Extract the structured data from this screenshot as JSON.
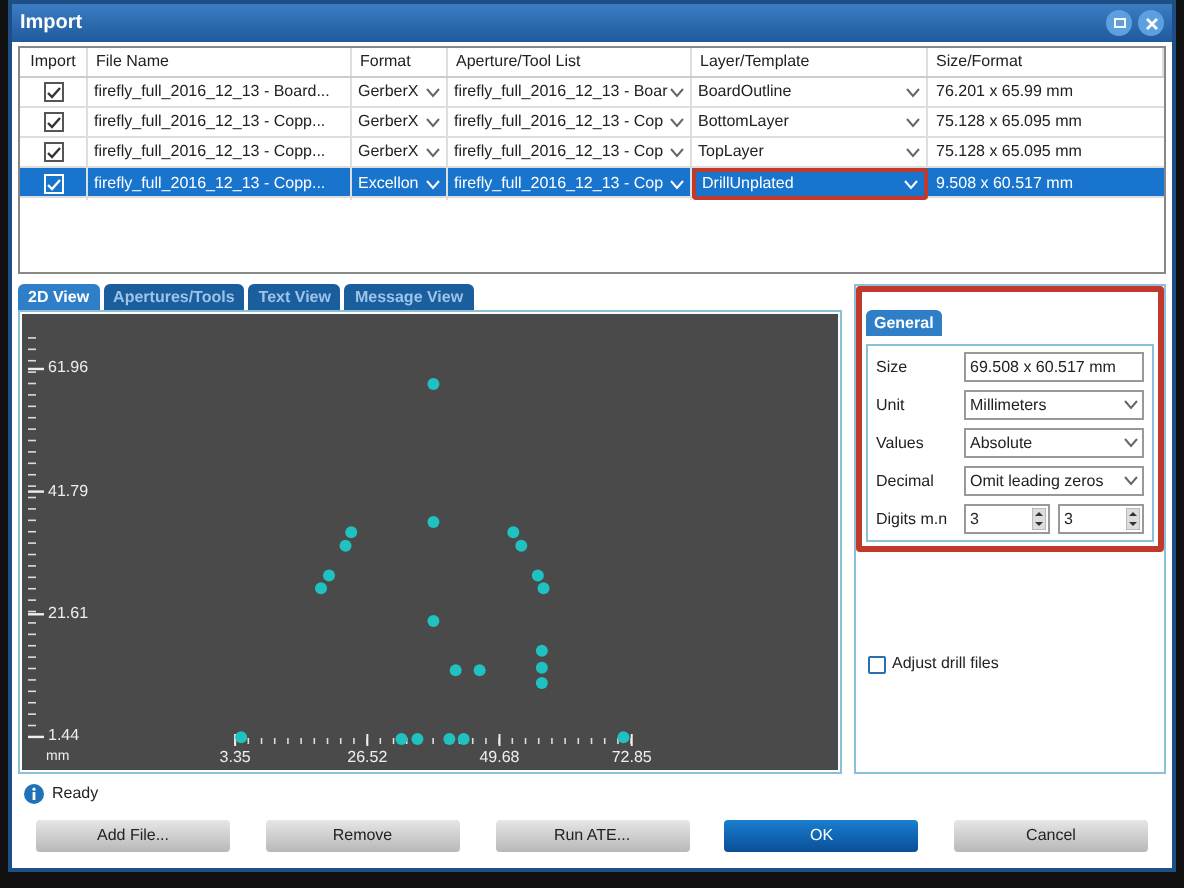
{
  "window": {
    "title": "Import"
  },
  "table": {
    "columns": [
      "Import",
      "File Name",
      "Format",
      "Aperture/Tool List",
      "Layer/Template",
      "Size/Format"
    ],
    "rows": [
      {
        "import": true,
        "file_name": "firefly_full_2016_12_13 - Board...",
        "format": "GerberX",
        "aperture_list": "firefly_full_2016_12_13 - Boar",
        "layer": "BoardOutline",
        "size": "76.201 x 65.99 mm",
        "selected": false,
        "highlighted": false
      },
      {
        "import": true,
        "file_name": "firefly_full_2016_12_13 - Copp...",
        "format": "GerberX",
        "aperture_list": "firefly_full_2016_12_13 - Cop",
        "layer": "BottomLayer",
        "size": "75.128 x 65.095 mm",
        "selected": false,
        "highlighted": false
      },
      {
        "import": true,
        "file_name": "firefly_full_2016_12_13 - Copp...",
        "format": "GerberX",
        "aperture_list": "firefly_full_2016_12_13 - Cop",
        "layer": "TopLayer",
        "size": "75.128 x 65.095 mm",
        "selected": false,
        "highlighted": false
      },
      {
        "import": true,
        "file_name": "firefly_full_2016_12_13 - Copp...",
        "format": "Excellon",
        "aperture_list": "firefly_full_2016_12_13 - Cop",
        "layer": "DrillUnplated",
        "size": "9.508 x 60.517 mm",
        "selected": true,
        "highlighted": true
      }
    ]
  },
  "view_tabs": [
    {
      "label": "2D View",
      "selected": true
    },
    {
      "label": "Apertures/Tools",
      "selected": false
    },
    {
      "label": "Text View",
      "selected": false
    },
    {
      "label": "Message View",
      "selected": false
    }
  ],
  "view": {
    "unit_label": "mm",
    "chart_data": {
      "type": "scatter",
      "x": [
        38.1,
        38.1,
        38.1,
        23.7,
        22.7,
        19.8,
        18.4,
        52.1,
        53.5,
        56.4,
        57.4,
        57.1,
        57.1,
        57.1,
        42.0,
        46.2,
        4.4,
        32.5,
        35.3,
        40.9,
        43.4,
        71.4
      ],
      "series": [
        {
          "color": "#1fc1c1",
          "values": [
            59.5,
            36.8,
            20.5,
            35.1,
            32.9,
            28.0,
            25.9,
            35.1,
            32.9,
            28.0,
            25.9,
            15.6,
            12.8,
            10.3,
            12.4,
            12.4,
            1.4,
            1.1,
            1.1,
            1.1,
            1.1,
            1.4
          ]
        }
      ],
      "xlim": [
        -34,
        109
      ],
      "ylim": [
        -4,
        71
      ],
      "xticks": [
        3.35,
        26.52,
        49.68,
        72.85
      ],
      "yticks": [
        1.44,
        21.61,
        41.79,
        61.96
      ]
    }
  },
  "properties": {
    "tab": "General",
    "highlighted": true,
    "fields": [
      {
        "label": "Size",
        "kind": "text",
        "value": "69.508 x 60.517 mm"
      },
      {
        "label": "Unit",
        "kind": "dropdown",
        "value": "Millimeters"
      },
      {
        "label": "Values",
        "kind": "dropdown",
        "value": "Absolute"
      },
      {
        "label": "Decimal",
        "kind": "dropdown",
        "value": "Omit leading zeros"
      },
      {
        "label": "Digits m.n",
        "kind": "spinners",
        "values": [
          "3",
          "3"
        ]
      }
    ]
  },
  "adjust_drill_files": {
    "label": "Adjust drill files",
    "checked": false
  },
  "status": "Ready",
  "buttons": [
    {
      "label": "Add File...",
      "primary": false
    },
    {
      "label": "Remove",
      "primary": false
    },
    {
      "label": "Run ATE...",
      "primary": false
    },
    {
      "label": "OK",
      "primary": true
    },
    {
      "label": "Cancel",
      "primary": false
    }
  ]
}
